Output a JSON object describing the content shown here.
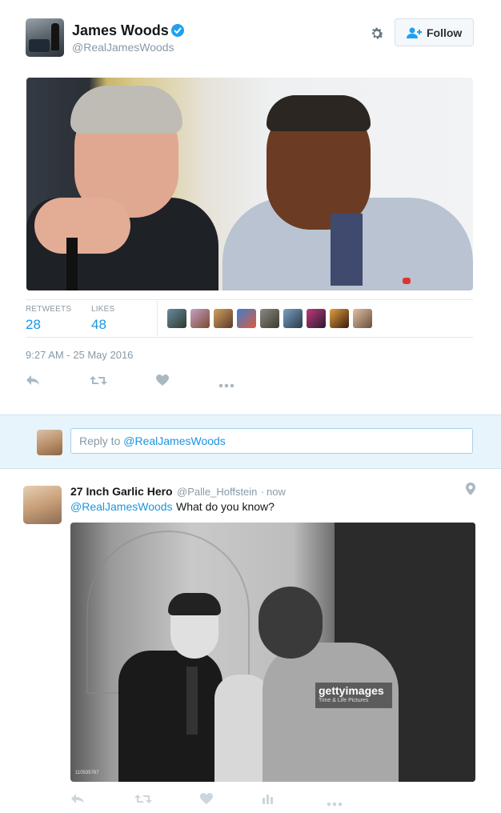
{
  "tweet": {
    "author_name": "James Woods",
    "author_handle": "@RealJamesWoods",
    "follow_label": "Follow",
    "retweets_label": "RETWEETS",
    "retweets_count": "28",
    "likes_label": "LIKES",
    "likes_count": "48",
    "timestamp": "9:27 AM - 25 May 2016",
    "icons": [
      "verified-badge-icon",
      "gear-icon",
      "follow-person-icon",
      "reply-icon",
      "retweet-icon",
      "like-heart-icon",
      "more-dots-icon"
    ]
  },
  "reply_box": {
    "prefix": "Reply to ",
    "mention": "@RealJamesWoods"
  },
  "reply_tweet": {
    "author_name": "27 Inch Garlic Hero",
    "author_handle": "@Palle_Hoffstein",
    "separator": "·",
    "time": "now",
    "mention": "@RealJamesWoods",
    "text": "What do you know?",
    "watermark_brand": "gettyimages",
    "watermark_credit": "Time & Life Pictures",
    "photo_id": "110535787",
    "icons": [
      "location-pin-icon",
      "reply-icon",
      "retweet-icon",
      "like-heart-icon",
      "analytics-icon",
      "more-dots-icon"
    ]
  },
  "colors": {
    "link_blue": "#1b95e0",
    "muted_gray": "#8899a6",
    "verified_blue": "#1da1f2",
    "reply_band": "#e8f4fb"
  }
}
